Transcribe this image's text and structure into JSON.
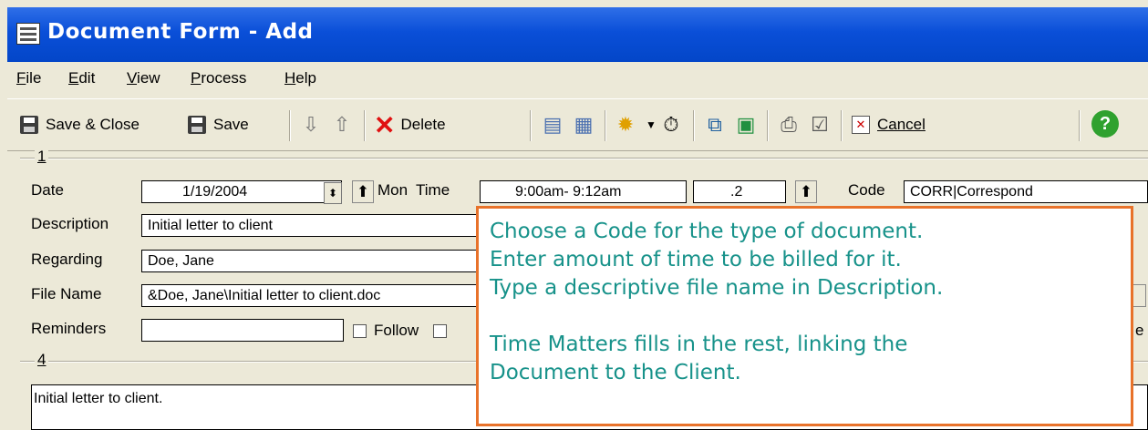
{
  "window": {
    "title": "Document Form - Add"
  },
  "menu": [
    "File",
    "Edit",
    "View",
    "Process",
    "Help"
  ],
  "toolbar": {
    "save_close": "Save & Close",
    "save": "Save",
    "delete": "Delete",
    "cancel": "Cancel"
  },
  "form": {
    "group1": "1",
    "group4": "4",
    "date_label": "Date",
    "date_value": "1/19/2004",
    "day_label": "Mon",
    "time_label": "Time",
    "time_value": "9:00am- 9:12am",
    "duration_value": ".2",
    "code_label": "Code",
    "code_value": "CORR|Correspond",
    "description_label": "Description",
    "description_value": "Initial letter to client",
    "regarding_label": "Regarding",
    "regarding_value": "Doe, Jane",
    "filename_label": "File Name",
    "filename_value": "&Doe, Jane\\Initial letter to client.doc",
    "reminders_label": "Reminders",
    "reminders_value": "",
    "follow_label": "Follow",
    "memo_text": "Initial letter to client."
  },
  "callout": {
    "lines": [
      "Choose a Code for the type of document.",
      "Enter amount of time to be billed for it.",
      "Type a descriptive file name in Description.",
      "Time Matters fills in the rest, linking the",
      "Document to the Client."
    ]
  },
  "colors": {
    "title_bar": "#0a4fd8",
    "callout_border": "#e8722a",
    "callout_text": "#17928a"
  }
}
